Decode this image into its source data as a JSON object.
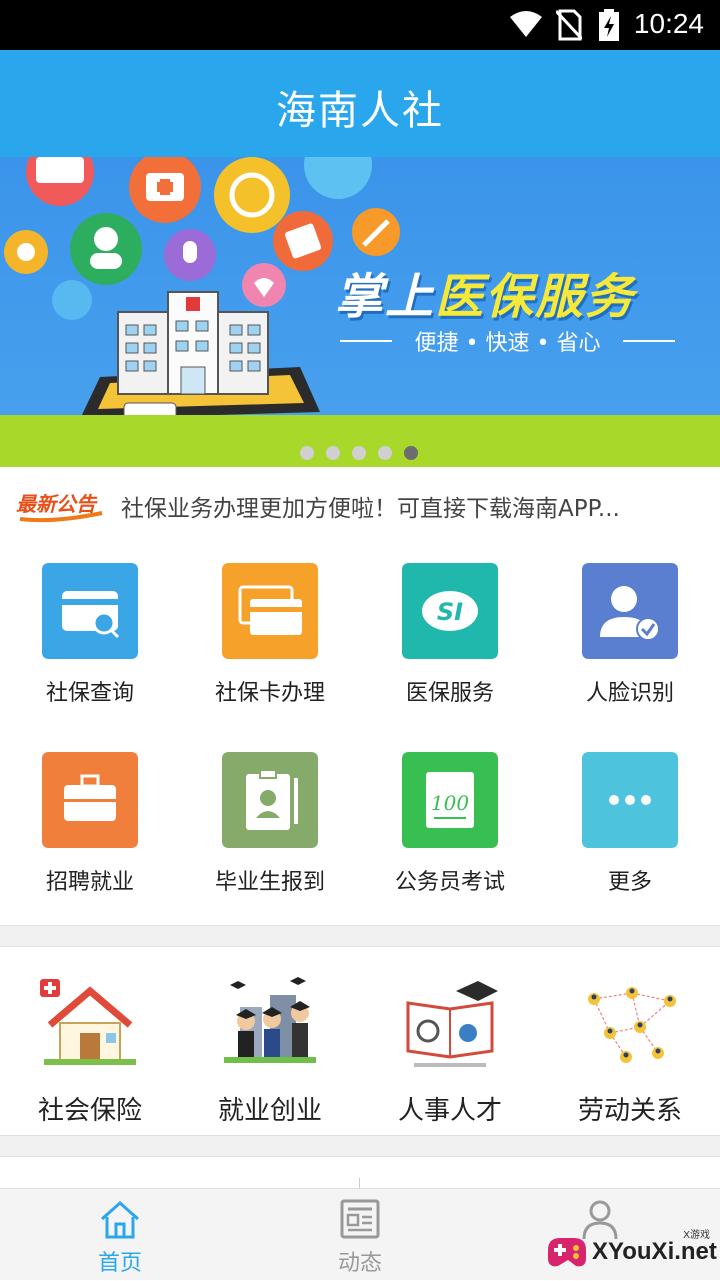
{
  "status_bar": {
    "time": "10:24"
  },
  "app_bar": {
    "title": "海南人社"
  },
  "banner": {
    "slogan_white": "掌上",
    "slogan_yellow": "医保服务",
    "subtitle": "便捷 • 快速 • 省心",
    "page_count": 5,
    "active_page": 5
  },
  "notice": {
    "tag": "最新公告",
    "text": "社保业务办理更加方便啦！可直接下载海南APP..."
  },
  "grid": [
    {
      "label": "社保查询",
      "icon": "card-search-icon",
      "color": "#3aa6e6"
    },
    {
      "label": "社保卡办理",
      "icon": "cards-icon",
      "color": "#f5a12a"
    },
    {
      "label": "医保服务",
      "icon": "si-logo-icon",
      "color": "#20b8ac"
    },
    {
      "label": "人脸识别",
      "icon": "face-verify-icon",
      "color": "#5a7fd1"
    },
    {
      "label": "招聘就业",
      "icon": "briefcase-icon",
      "color": "#f07f3c"
    },
    {
      "label": "毕业生报到",
      "icon": "id-badge-icon",
      "color": "#86aa6a"
    },
    {
      "label": "公务员考试",
      "icon": "exam-paper-icon",
      "color": "#38bf52"
    },
    {
      "label": "更多",
      "icon": "more-dots-icon",
      "color": "#4ec3dd"
    }
  ],
  "categories": [
    {
      "label": "社会保险",
      "icon": "house-icon"
    },
    {
      "label": "就业创业",
      "icon": "graduates-icon"
    },
    {
      "label": "人事人才",
      "icon": "book-graduation-icon"
    },
    {
      "label": "劳动关系",
      "icon": "network-people-icon"
    }
  ],
  "tabs": [
    {
      "label": "首页",
      "icon": "home-icon",
      "active": true
    },
    {
      "label": "动态",
      "icon": "news-icon",
      "active": false
    },
    {
      "label": "",
      "icon": "user-icon",
      "active": false
    }
  ],
  "watermark": {
    "text": "XYouXi.net",
    "small": "X游戏"
  },
  "colors": {
    "primary": "#2aa7ec",
    "tab_active": "#2aa7ec",
    "tab_inactive": "#999999"
  }
}
